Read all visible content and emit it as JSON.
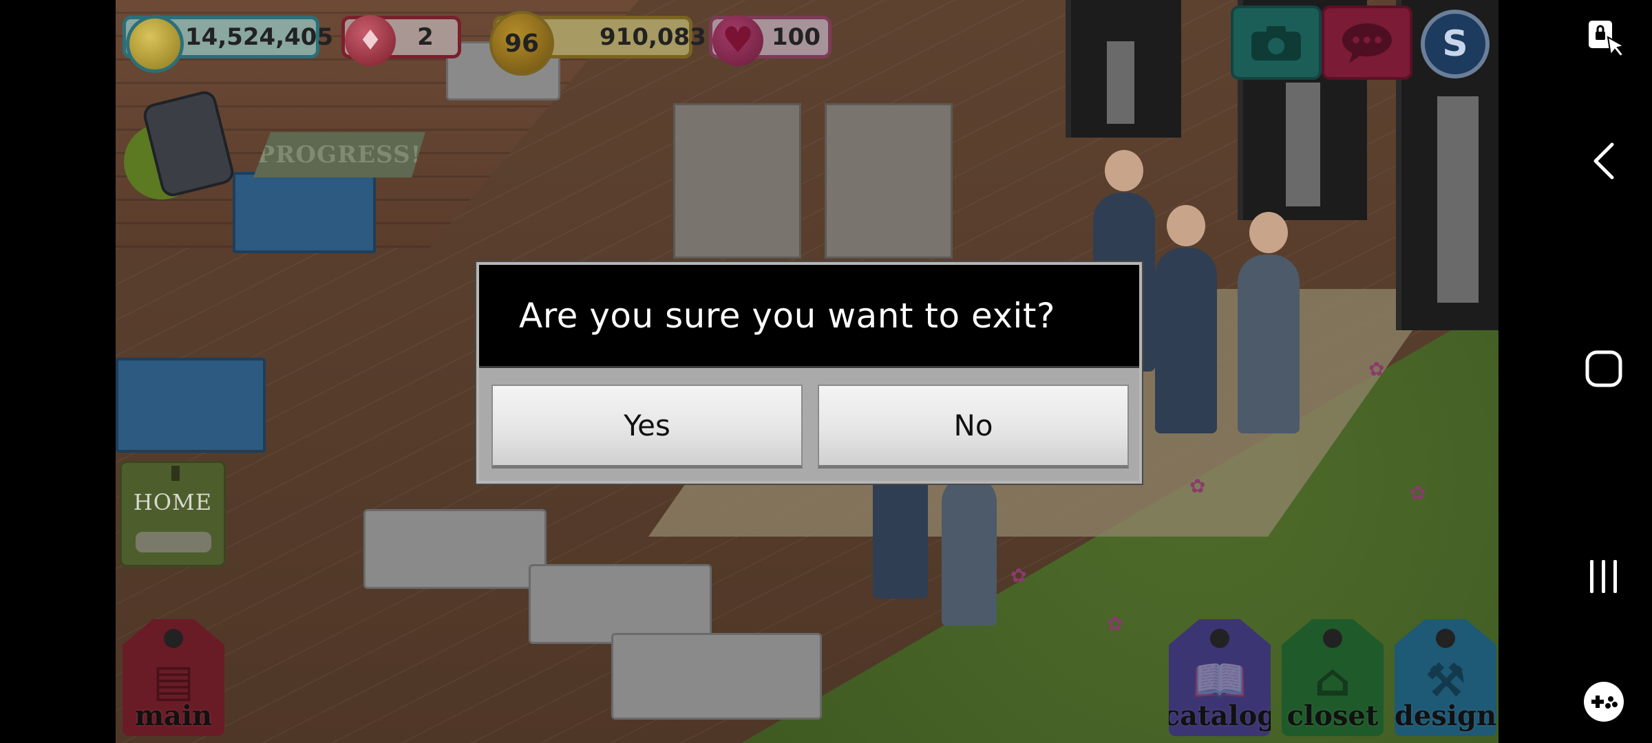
{
  "hud": {
    "coins": "14,524,405",
    "gems": "2",
    "level": "96",
    "experience": "910,083",
    "hearts": "100"
  },
  "banners": {
    "progress": "PROGRESS!"
  },
  "left_buttons": {
    "home_label": "HOME"
  },
  "tags": {
    "main": "main",
    "catalog": "catalog",
    "closet": "closet",
    "design": "design"
  },
  "top_right": {
    "s_label": "S"
  },
  "dialog": {
    "title": "Are you sure you want to exit?",
    "yes_label": "Yes",
    "no_label": "No"
  },
  "icons": {
    "coins": "coin-icon",
    "gems": "diamond-icon",
    "level": "level-star-icon",
    "hearts": "heart-icon",
    "camera": "camera-icon",
    "chat": "chat-icon",
    "phone": "phone-icon",
    "nav_screen_lock": "screen-lock-icon",
    "nav_back": "back-icon",
    "nav_home": "home-icon",
    "nav_recents": "recents-icon",
    "nav_gamepad": "gamepad-icon"
  },
  "colors": {
    "dialog_header": "#000000",
    "dialog_body": "#aaaaaa",
    "nav_bar": "#000000",
    "icon_white": "#ffffff"
  }
}
